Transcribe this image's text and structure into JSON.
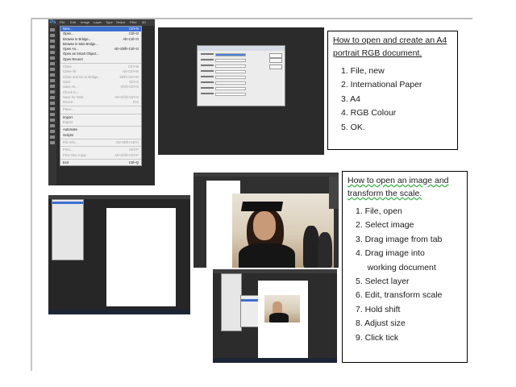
{
  "screenshot1": {
    "app_logo": "Ps",
    "menubar": [
      "File",
      "Edit",
      "Image",
      "Layer",
      "Type",
      "Select",
      "Filter",
      "3D"
    ],
    "file_menu": [
      {
        "label": "New...",
        "shortcut": "Ctrl+N",
        "state": "highlight"
      },
      {
        "label": "Open...",
        "shortcut": "Ctrl+O",
        "state": "normal"
      },
      {
        "label": "Browse in Bridge...",
        "shortcut": "Alt+Ctrl+O",
        "state": "normal"
      },
      {
        "label": "Browse in Mini Bridge...",
        "shortcut": "",
        "state": "normal"
      },
      {
        "label": "Open As...",
        "shortcut": "Alt+Shift+Ctrl+O",
        "state": "normal"
      },
      {
        "label": "Open as Smart Object...",
        "shortcut": "",
        "state": "normal"
      },
      {
        "label": "Open Recent",
        "shortcut": "",
        "state": "normal"
      },
      {
        "sep": true
      },
      {
        "label": "Close",
        "shortcut": "Ctrl+W",
        "state": "disabled"
      },
      {
        "label": "Close All",
        "shortcut": "Alt+Ctrl+W",
        "state": "disabled"
      },
      {
        "label": "Close and Go to Bridge...",
        "shortcut": "Shift+Ctrl+W",
        "state": "disabled"
      },
      {
        "label": "Save",
        "shortcut": "Ctrl+S",
        "state": "disabled"
      },
      {
        "label": "Save As...",
        "shortcut": "Shift+Ctrl+S",
        "state": "disabled"
      },
      {
        "label": "Check In...",
        "shortcut": "",
        "state": "disabled"
      },
      {
        "label": "Save for Web...",
        "shortcut": "Alt+Shift+Ctrl+S",
        "state": "disabled"
      },
      {
        "label": "Revert",
        "shortcut": "F12",
        "state": "disabled"
      },
      {
        "sep": true
      },
      {
        "label": "Place...",
        "shortcut": "",
        "state": "disabled"
      },
      {
        "sep": true
      },
      {
        "label": "Import",
        "shortcut": "",
        "state": "normal"
      },
      {
        "label": "Export",
        "shortcut": "",
        "state": "disabled"
      },
      {
        "sep": true
      },
      {
        "label": "Automate",
        "shortcut": "",
        "state": "normal"
      },
      {
        "label": "Scripts",
        "shortcut": "",
        "state": "normal"
      },
      {
        "sep": true
      },
      {
        "label": "File Info...",
        "shortcut": "Alt+Shift+Ctrl+I",
        "state": "disabled"
      },
      {
        "sep": true
      },
      {
        "label": "Print...",
        "shortcut": "Ctrl+P",
        "state": "disabled"
      },
      {
        "label": "Print One Copy",
        "shortcut": "Alt+Shift+Ctrl+P",
        "state": "disabled"
      },
      {
        "sep": true
      },
      {
        "label": "Exit",
        "shortcut": "Ctrl+Q",
        "state": "normal"
      }
    ]
  },
  "box1": {
    "title": "How to open and create an A4 portrait RGB document.",
    "steps": [
      "1.  File, new",
      "2.  International Paper",
      "3.  A4",
      "4.  RGB Colour",
      "5.  OK."
    ]
  },
  "box2": {
    "title": "How to open an image and transform the scale.",
    "steps": [
      "1.  File, open",
      "2.  Select image",
      "3.  Drag image from tab",
      "4.  Drag image into",
      "     working document",
      "5.  Select layer",
      "6.  Edit, transform scale",
      "7.  Hold shift",
      "8.  Adjust size",
      "9.  Click tick"
    ]
  },
  "colors": {
    "ps_dark": "#2b2b2b",
    "menu_highlight": "#3b6fd1",
    "text": "#1a1a1a"
  }
}
